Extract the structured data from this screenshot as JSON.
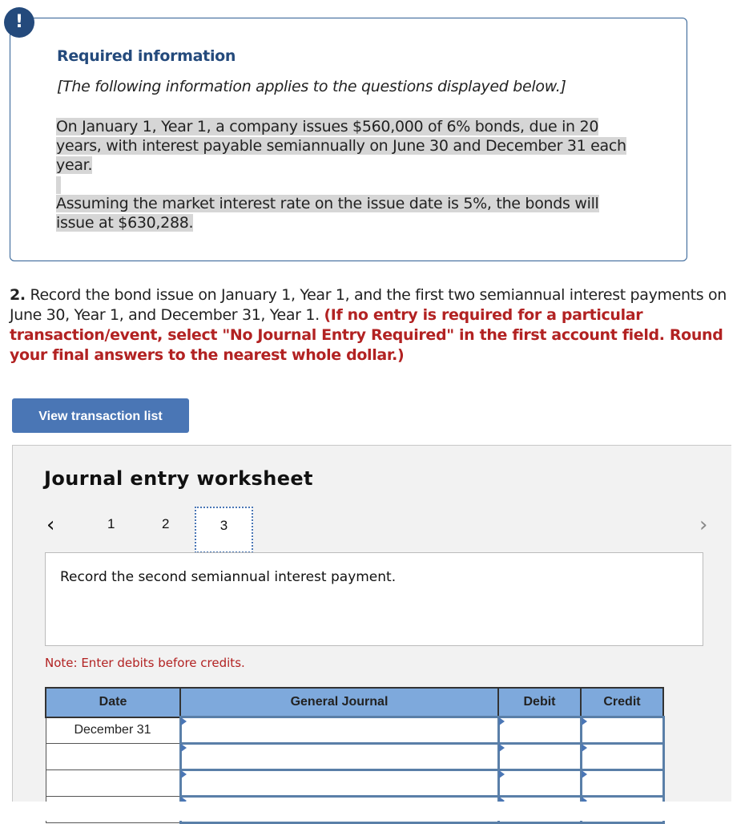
{
  "required_info": {
    "alert_icon": "!",
    "title": "Required information",
    "subtitle": "[The following information applies to the questions displayed below.]",
    "paragraph1": "On January 1, Year 1, a company issues $560,000 of 6% bonds, due in 20 years, with interest payable semiannually on June 30 and December 31 each year.",
    "paragraph2": "Assuming the market interest rate on the issue date is 5%, the bonds will issue at $630,288."
  },
  "question": {
    "number": "2.",
    "text": " Record the bond issue on January 1, Year 1, and the first two semiannual interest payments on June 30, Year 1, and December 31, Year 1. ",
    "instruction": "(If no entry is required for a particular transaction/event, select \"No Journal Entry Required\" in the first account field. Round your final answers to the nearest whole dollar.)"
  },
  "buttons": {
    "view_transaction_list": "View transaction list"
  },
  "worksheet": {
    "title": "Journal entry worksheet",
    "prev_icon": "‹",
    "next_icon": "›",
    "tabs": [
      "1",
      "2",
      "3"
    ],
    "active_tab": "3",
    "instruction": "Record the second semiannual interest payment.",
    "note": "Note: Enter debits before credits.",
    "table": {
      "headers": [
        "Date",
        "General Journal",
        "Debit",
        "Credit"
      ],
      "rows": [
        {
          "date": "December 31",
          "account": "",
          "debit": "",
          "credit": ""
        },
        {
          "date": "",
          "account": "",
          "debit": "",
          "credit": ""
        },
        {
          "date": "",
          "account": "",
          "debit": "",
          "credit": ""
        },
        {
          "date": "",
          "account": "",
          "debit": "",
          "credit": ""
        }
      ]
    }
  }
}
